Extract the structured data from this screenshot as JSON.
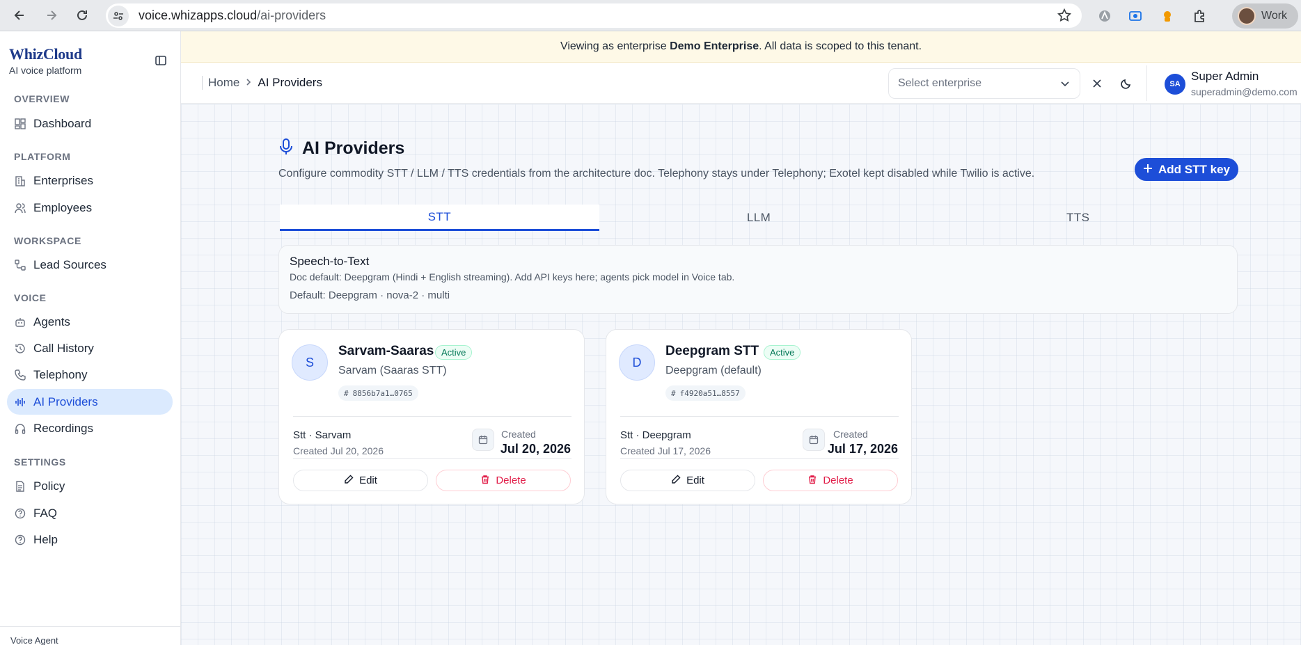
{
  "browser": {
    "url_host": "voice.whizapps.cloud",
    "url_path": "/ai-providers",
    "profile_label": "Work"
  },
  "sidebar": {
    "brand": "WhizCloud",
    "tagline": "AI voice platform",
    "sections": [
      {
        "title": "OVERVIEW",
        "items": [
          {
            "label": "Dashboard",
            "icon": "dashboard-icon"
          }
        ]
      },
      {
        "title": "PLATFORM",
        "items": [
          {
            "label": "Enterprises",
            "icon": "building-icon"
          },
          {
            "label": "Employees",
            "icon": "users-icon"
          }
        ]
      },
      {
        "title": "WORKSPACE",
        "items": [
          {
            "label": "Lead Sources",
            "icon": "workflow-icon"
          }
        ]
      },
      {
        "title": "VOICE",
        "items": [
          {
            "label": "Agents",
            "icon": "bot-icon"
          },
          {
            "label": "Call History",
            "icon": "history-icon"
          },
          {
            "label": "Telephony",
            "icon": "phone-icon"
          },
          {
            "label": "AI Providers",
            "icon": "audio-lines-icon",
            "active": true
          },
          {
            "label": "Recordings",
            "icon": "headphones-icon"
          }
        ]
      },
      {
        "title": "SETTINGS",
        "items": [
          {
            "label": "Policy",
            "icon": "document-icon"
          },
          {
            "label": "FAQ",
            "icon": "help-circle-icon"
          },
          {
            "label": "Help",
            "icon": "help-circle-icon"
          }
        ]
      }
    ],
    "footer": "Voice Agent"
  },
  "banner": {
    "prefix": "Viewing as enterprise ",
    "enterprise": "Demo Enterprise",
    "suffix": ". All data is scoped to this tenant."
  },
  "header": {
    "breadcrumb_home": "Home",
    "breadcrumb_current": "AI Providers",
    "select_placeholder": "Select enterprise",
    "user_initials": "SA",
    "user_name": "Super Admin",
    "user_email": "superadmin@demo.com"
  },
  "page": {
    "title": "AI Providers",
    "description": "Configure commodity STT / LLM / TTS credentials from the architecture doc. Telephony stays under Telephony; Exotel kept disabled while Twilio is active.",
    "add_button": "Add STT key",
    "tabs": [
      "STT",
      "LLM",
      "TTS"
    ],
    "active_tab": "STT",
    "info": {
      "title": "Speech-to-Text",
      "description": "Doc default: Deepgram (Hindi + English streaming). Add API keys here; agents pick model in Voice tab.",
      "default": "Default: Deepgram · nova-2 · multi"
    },
    "cards": [
      {
        "initial": "S",
        "name": "Sarvam-Saaras",
        "status": "Active",
        "provider": "Sarvam (Saaras STT)",
        "key_id": "8856b7a1…0765",
        "kind": "Stt · Sarvam",
        "created_small": "Created Jul 20, 2026",
        "created_label": "Created",
        "created_date": "Jul 20, 2026",
        "edit_label": "Edit",
        "delete_label": "Delete"
      },
      {
        "initial": "D",
        "name": "Deepgram STT",
        "status": "Active",
        "provider": "Deepgram (default)",
        "key_id": "f4920a51…8557",
        "kind": "Stt · Deepgram",
        "created_small": "Created Jul 17, 2026",
        "created_label": "Created",
        "created_date": "Jul 17, 2026",
        "edit_label": "Edit",
        "delete_label": "Delete"
      }
    ]
  },
  "colors": {
    "accent": "#1d4ed8",
    "active_nav_bg": "#dbeafe",
    "banner_bg": "#fef9e7",
    "danger": "#e11d48",
    "success": "#047857"
  }
}
